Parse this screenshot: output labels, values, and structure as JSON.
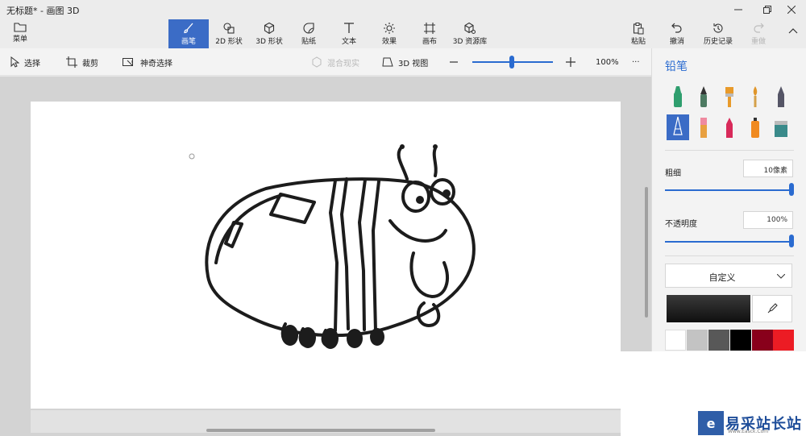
{
  "window": {
    "title": "无标题* - 画图 3D"
  },
  "ribbon": {
    "menu": "菜单",
    "tabs": [
      "画笔",
      "2D 形状",
      "3D 形状",
      "贴纸",
      "文本",
      "效果",
      "画布",
      "3D 资源库"
    ],
    "active_tab": "画笔",
    "right": [
      "粘贴",
      "撤消",
      "历史记录",
      "重做"
    ]
  },
  "toolbar": {
    "select": "选择",
    "crop": "裁剪",
    "magic_select": "神奇选择",
    "mixed_reality": "混合现实",
    "view_3d": "3D 视图",
    "zoom_value": "100%",
    "zoom_fraction": 0.5,
    "more": "···"
  },
  "panel": {
    "title": "铅笔",
    "brushes": [
      "marker",
      "calligraphy-pen",
      "oil-brush",
      "watercolor",
      "pencil",
      "pixel-pen",
      "eraser",
      "crayon",
      "spray-can",
      "fill"
    ],
    "selected_brush": "pixel-pen",
    "thickness_label": "粗细",
    "thickness_value": "10像素",
    "opacity_label": "不透明度",
    "opacity_value": "100%",
    "color_mode": "自定义",
    "current_color": "#1a1a1a",
    "swatches": [
      "#ffffff",
      "#c3c3c3",
      "#585858",
      "#000000",
      "#88001b",
      "#ec1c24"
    ]
  },
  "watermark": {
    "logo": "e",
    "name": "易采站长站",
    "url": "Www.Easck.Com"
  }
}
